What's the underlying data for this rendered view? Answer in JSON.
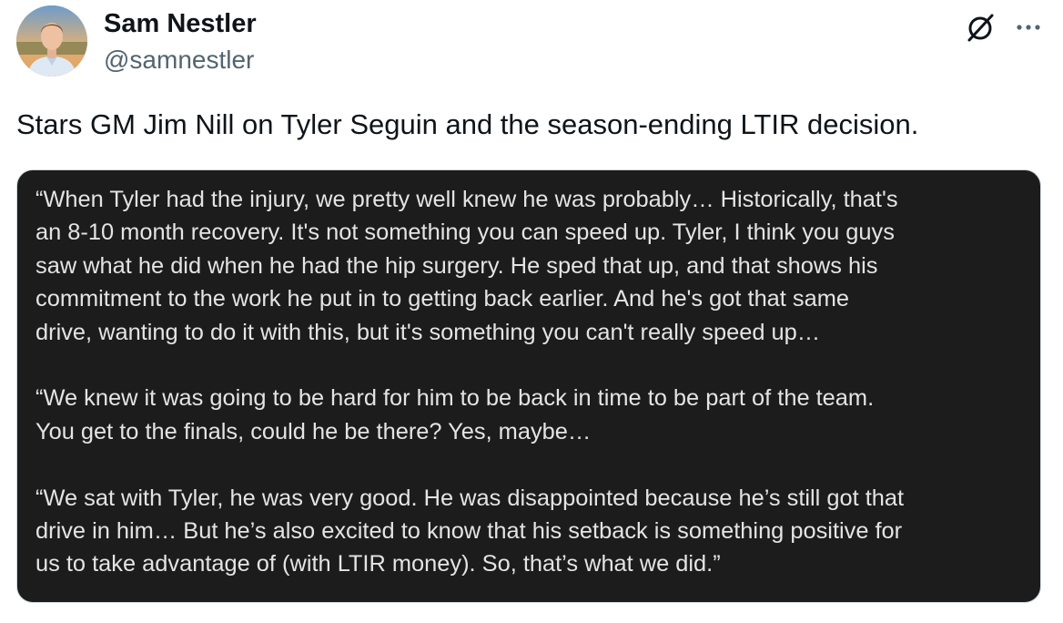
{
  "author": {
    "name": "Sam Nestler",
    "handle": "@samnestler"
  },
  "icons": {
    "avatar": "profile-photo",
    "grok": "grok-slash-circle-icon",
    "more": "more-dots-icon"
  },
  "tweet": {
    "text": "Stars GM Jim Nill on Tyler Seguin and the season-ending LTIR decision."
  },
  "quote_image": {
    "background": "#1c1c1c",
    "text_color": "#e4e4e4",
    "paragraphs": [
      "“When Tyler had the injury, we pretty well knew he was probably… Historically, that's\nan 8-10 month recovery. It's not something you can speed up. Tyler, I think you guys\nsaw what he did when he had the hip surgery. He sped that up, and that shows his\ncommitment to the work he put in to getting back earlier. And he's got that same\ndrive, wanting to do it with this, but it's something you can't really speed up…",
      "“We knew it was going to be hard for him to be back in time to be part of the team.\nYou get to the finals, could he be there? Yes, maybe…",
      "“We sat with Tyler, he was very good. He was disappointed because he’s still got that\ndrive in him… But he’s also excited to know that his setback is something positive for\nus to take advantage of (with LTIR money). So, that’s what we did.”"
    ]
  }
}
